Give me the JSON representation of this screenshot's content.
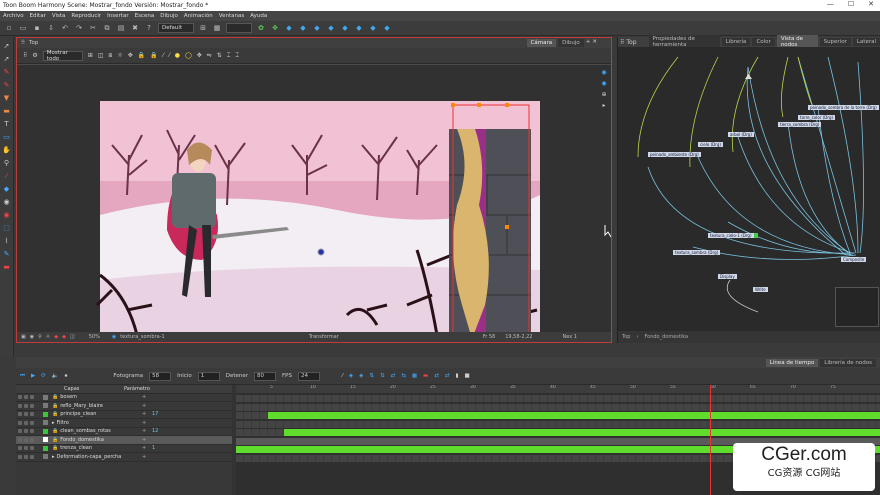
{
  "app": {
    "title": "Toon Boom Harmony Scene: Mostrar_fondo Versión: Mostrar_fondo *"
  },
  "menu": [
    "Archivo",
    "Editar",
    "Vista",
    "Reproducir",
    "Insertar",
    "Escena",
    "Dibujo",
    "Animación",
    "Ventanas",
    "Ayuda"
  ],
  "toolbar": {
    "workspace_select": "Default"
  },
  "camera": {
    "header_label": "Top",
    "tabs": [
      "Cámara",
      "Dibujo"
    ],
    "show_all_select": "Mostrar todo",
    "zoom": "50%",
    "current_layer": "textura_sombra-1",
    "mode": "Transformar",
    "frame": "Fr 58",
    "coords": "19,58-2,22",
    "view_label": "Nex 1"
  },
  "nodeview": {
    "header_label": "Top",
    "tabs": [
      "Propiedades de herramienta",
      "Librería",
      "Color",
      "Vista de nodos",
      "Superior",
      "Lateral"
    ],
    "breadcrumb_top": "Top",
    "breadcrumb_sub": "Fondo_domestika",
    "nodes": [
      {
        "label": "peinado_sombra de la torre (Drg)"
      },
      {
        "label": "torre_color (Drg)"
      },
      {
        "label": "tierra_sombra (Drg)"
      },
      {
        "label": "arbol (Drg)"
      },
      {
        "label": "cielo (Drg)"
      },
      {
        "label": "peinado_ambiente (Drg)"
      },
      {
        "label": "textura_cielo-1 (Drg)"
      },
      {
        "label": "textura_sombra (Drg)"
      },
      {
        "label": "Composite"
      },
      {
        "label": "Display"
      },
      {
        "label": "Write"
      }
    ]
  },
  "timeline": {
    "tabs": [
      "Línea de tiempo",
      "Librería de nodos"
    ],
    "fotograma_label": "Fotograma",
    "fotograma_value": "58",
    "inicio_label": "Inicio",
    "inicio_value": "1",
    "detener_label": "Detener",
    "detener_value": "80",
    "fps_label": "FPS",
    "fps_value": "24",
    "col_capas": "Capas",
    "col_parametros": "Parámetro",
    "layers": [
      {
        "name": "bosem",
        "color": "#7a7a7a",
        "num": ""
      },
      {
        "name": "reflo_Mary_blaire",
        "color": "#7a7a7a",
        "num": ""
      },
      {
        "name": "principe_clean",
        "color": "#3ac43a",
        "num": "17"
      },
      {
        "name": "Filtro",
        "color": "#7a7a7a",
        "num": ""
      },
      {
        "name": "clean_sombas_rotas",
        "color": "#3ac43a",
        "num": "12"
      },
      {
        "name": "Fondo_domestika",
        "color": "#ffffff",
        "num": ""
      },
      {
        "name": "trenza_clean",
        "color": "#3ac43a",
        "num": "1"
      },
      {
        "name": "Deformation-capa_percha",
        "color": "#7a7a7a",
        "num": ""
      }
    ],
    "tick_labels": [
      "5",
      "10",
      "15",
      "20",
      "25",
      "30",
      "35",
      "40",
      "45",
      "50",
      "55",
      "60",
      "65",
      "70",
      "75"
    ]
  },
  "watermark": {
    "main": "CGer.com",
    "sub": "CG资源 CG网站"
  }
}
